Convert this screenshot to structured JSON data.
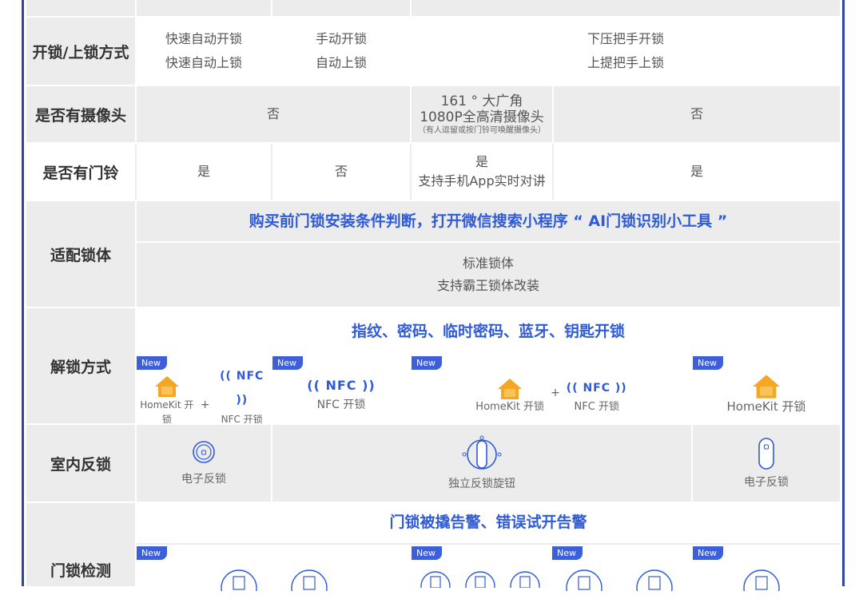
{
  "rows": {
    "mode": {
      "label": "开锁/上锁方式",
      "c1": [
        "快速自动开锁",
        "快速自动上锁"
      ],
      "c2": [
        "手动开锁",
        "自动上锁"
      ],
      "c3": [
        "下压把手开锁",
        "上提把手上锁"
      ]
    },
    "camera": {
      "label": "是否有摄像头",
      "c1": "否",
      "c2": [
        "161 ° 大广角",
        "1080P全高清摄像头",
        "（有人逗留或按门铃可唤醒摄像头）"
      ],
      "c3": "否"
    },
    "doorbell": {
      "label": "是否有门铃",
      "c1": "是",
      "c2": "否",
      "c3": [
        "是",
        "支持手机App实时对讲"
      ],
      "c4": "是"
    },
    "lockbody": {
      "label": "适配锁体",
      "notice": "购买前门锁安装条件判断，打开微信搜索小程序 “ AI门锁识别小工具 ”",
      "lines": [
        "标准锁体",
        "支持霸王锁体改装"
      ]
    },
    "unlock": {
      "label": "解锁方式",
      "methods": "指纹、密码、临时密码、蓝牙、钥匙开锁",
      "badge": "New",
      "homekit": "HomeKit 开锁",
      "nfc": "NFC 开锁",
      "nfc_mark": "NFC",
      "plus": "+"
    },
    "inner": {
      "label": "室内反锁",
      "c1": "电子反锁",
      "c2": "独立反锁旋钮",
      "c3": "电子反锁"
    },
    "detect": {
      "label": "门锁检测",
      "alarm": "门锁被撬告警、错误试开告警",
      "badge": "New"
    }
  },
  "icons": [
    "home-icon",
    "nfc-icon",
    "knob-icon",
    "button-icon",
    "sensor-icon"
  ],
  "colors": {
    "accent": "#2f5bd6",
    "border": "#2d44a8",
    "badge": "#3d5fd9",
    "home": "#f5a623",
    "gray": "#ececec"
  }
}
